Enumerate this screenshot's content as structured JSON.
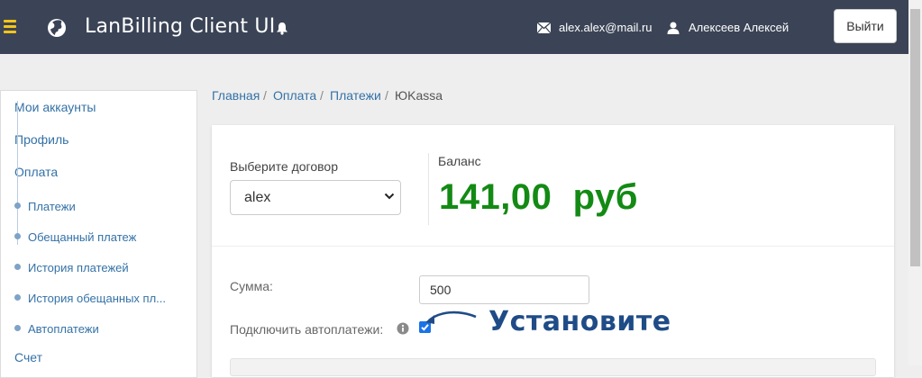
{
  "header": {
    "app_title": "LanBilling Client UI",
    "user_email": "alex.alex@mail.ru",
    "user_name": "Алексеев Алексей",
    "logout_label": "Выйти",
    "icons": [
      "menu-icon",
      "globe-icon",
      "bell-icon",
      "mail-icon",
      "user-icon"
    ],
    "accent_color": "#f5c518",
    "background_color": "#3b4456"
  },
  "sidebar": {
    "items": [
      {
        "label": "Мои аккаунты"
      },
      {
        "label": "Профиль"
      },
      {
        "label": "Оплата"
      }
    ],
    "sub_items": [
      {
        "label": "Платежи"
      },
      {
        "label": "Обещанный платеж"
      },
      {
        "label": "История платежей"
      },
      {
        "label": "История обещанных пл..."
      },
      {
        "label": "Автоплатежи"
      }
    ],
    "after_items": [
      {
        "label": "Счет"
      }
    ]
  },
  "breadcrumb": {
    "items": [
      "Главная",
      "Оплата",
      "Платежи",
      "ЮKassa"
    ],
    "separator": "/"
  },
  "contract": {
    "label": "Выберите договор",
    "selected": "alex"
  },
  "balance": {
    "label": "Баланс",
    "value": "141,00  руб",
    "color": "#138a14"
  },
  "form": {
    "sum_label": "Сумма:",
    "sum_value": "500",
    "autopay_label": "Подключить автоплатежи:",
    "autopay_checked": true
  },
  "annotation": {
    "text": "Установите",
    "color": "#1f4c87"
  }
}
